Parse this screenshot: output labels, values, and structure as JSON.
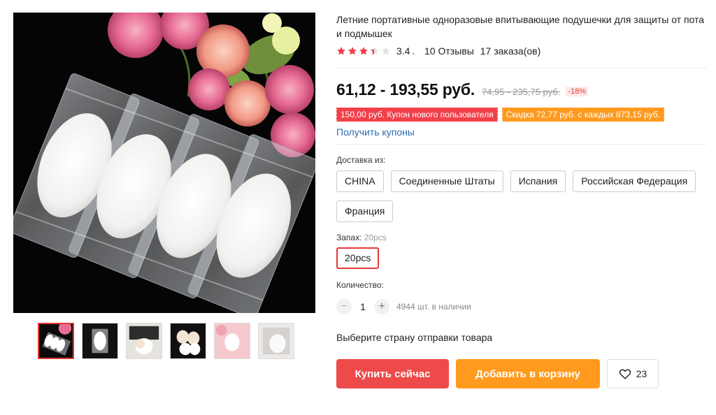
{
  "product": {
    "title": "Летние портативные одноразовые впитывающие подушечки для защиты от пота и подмышек",
    "rating": "3.4",
    "rating_stars": 3.4,
    "reviews": "10 Отзывы",
    "orders": "17 заказа(ов)"
  },
  "price": {
    "current": "61,12 - 193,55 руб.",
    "original": "74,95 - 235,75 руб.",
    "discount": "-18%"
  },
  "coupons": {
    "new_user": "150,00 руб. Купон нового пользователя",
    "discount": "Скидка 72,77 руб. с каждых 873,15 руб.",
    "get_link": "Получить купоны"
  },
  "shipping": {
    "label": "Доставка из:",
    "options": [
      "CHINA",
      "Соединенные Штаты",
      "Испания",
      "Российская Федерация",
      "Франция"
    ]
  },
  "scent": {
    "label": "Запах:",
    "selected": "20pcs",
    "options": [
      "20pcs"
    ]
  },
  "quantity": {
    "label": "Количество:",
    "value": "1",
    "minus": "−",
    "plus": "+",
    "stock": "4944 шт. в наличии"
  },
  "ship_note": "Выберите страну отправки товара",
  "actions": {
    "buy": "Купить сейчас",
    "cart": "Добавить в корзину",
    "wishlist_count": "23"
  },
  "colors": {
    "accent_red": "#ee4a4a",
    "accent_orange": "#ff9a1e",
    "star": "#f2404a",
    "link": "#2b6cb0"
  },
  "icons": {
    "wishlist": "heart-icon",
    "rating_caret": "chevron-down-icon"
  }
}
